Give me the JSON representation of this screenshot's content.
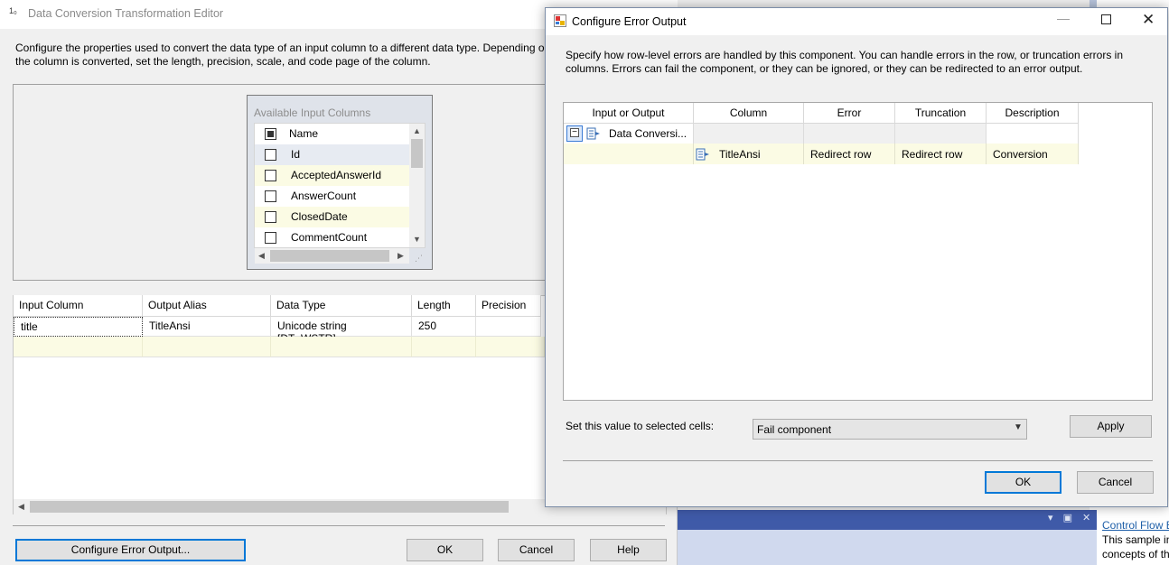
{
  "bg_dialog": {
    "title": "Data Conversion Transformation Editor",
    "title_icon_text": "1₀",
    "description_line1": "Configure the properties used to convert the data type of an input column to a different data type. Depending on",
    "description_line2": "the column is converted, set the length, precision, scale, and code page of the column.",
    "available_columns": {
      "title": "Available Input Columns",
      "header": "Name",
      "items": [
        "Id",
        "AcceptedAnswerId",
        "AnswerCount",
        "ClosedDate",
        "CommentCount"
      ]
    },
    "grid": {
      "headers": [
        "Input Column",
        "Output Alias",
        "Data Type",
        "Length",
        "Precision"
      ],
      "rows": [
        [
          "title",
          "TitleAnsi",
          "Unicode string [DT_WSTR]",
          "250",
          ""
        ]
      ]
    },
    "buttons": {
      "configure_error_output": "Configure Error Output...",
      "ok": "OK",
      "cancel": "Cancel",
      "help": "Help"
    }
  },
  "ide_panel": {
    "link": "Control Flow E",
    "text_line1": "This sample in",
    "text_line2": "concepts of th"
  },
  "fg_dialog": {
    "title": "Configure Error Output",
    "description": "Specify how row-level errors are handled by this component. You can handle errors in the row, or truncation errors in columns. Errors can fail the component, or they can be ignored, or they can be redirected to an error output.",
    "grid": {
      "headers": [
        "Input or Output",
        "Column",
        "Error",
        "Truncation",
        "Description"
      ],
      "group_row": "Data Conversi...",
      "rows": [
        {
          "column": "TitleAnsi",
          "error": "Redirect row",
          "truncation": "Redirect row",
          "description": "Conversion"
        }
      ]
    },
    "set_value_label": "Set this value to selected cells:",
    "set_value_selected": "Fail component",
    "buttons": {
      "apply": "Apply",
      "ok": "OK",
      "cancel": "Cancel"
    }
  },
  "colors": {
    "accent_blue": "#0078d7",
    "row_highlight": "#fbfbe4",
    "ide_header": "#3f5aa8"
  }
}
